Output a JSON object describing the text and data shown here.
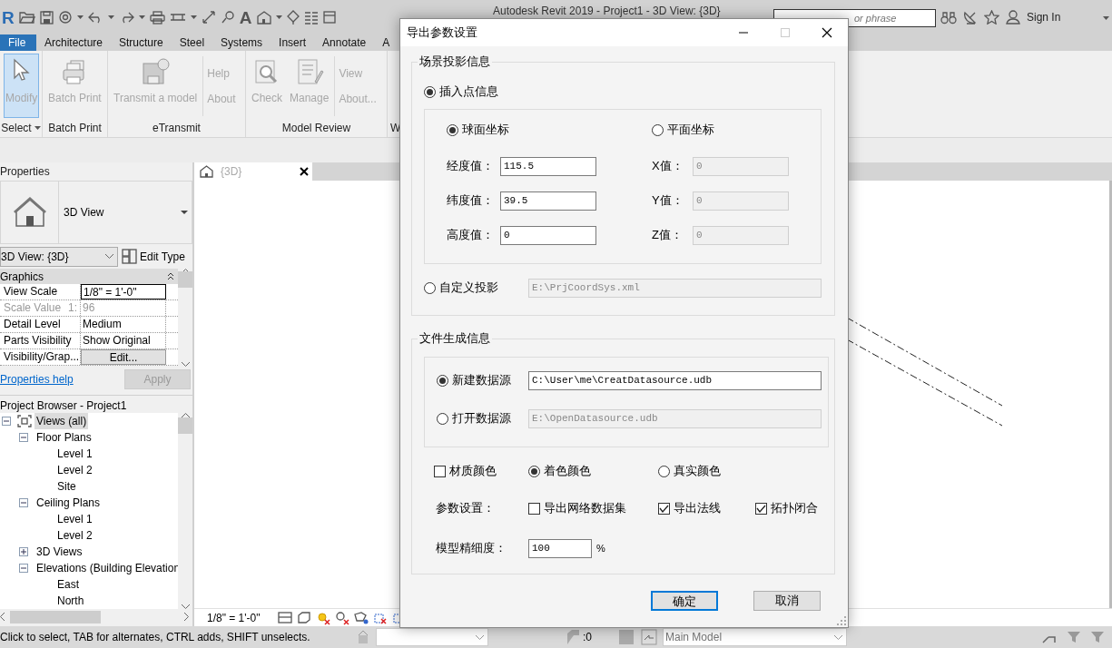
{
  "app": {
    "logo": "R",
    "text_tool": "A",
    "title": "Autodesk Revit 2019 - Project1 - 3D View: {3D}",
    "search": {
      "placeholder": "or phrase"
    },
    "sign_in": "Sign In"
  },
  "ribbon_tabs": [
    {
      "label": "File",
      "kind": "file"
    },
    {
      "label": "Architecture",
      "kind": "tab"
    },
    {
      "label": "Structure",
      "kind": "tab"
    },
    {
      "label": "Steel",
      "kind": "tab"
    },
    {
      "label": "Systems",
      "kind": "tab"
    },
    {
      "label": "Insert",
      "kind": "tab"
    },
    {
      "label": "Annotate",
      "kind": "tab"
    },
    {
      "label": "A",
      "kind": "tab"
    }
  ],
  "ribbon_panels": [
    {
      "label": "Select",
      "dropdown": true,
      "items": [
        {
          "kind": "large",
          "label": "Modify",
          "selected": true
        }
      ]
    },
    {
      "label": "Batch Print",
      "items": [
        {
          "kind": "large",
          "label": "Batch Print",
          "selected": false
        }
      ]
    },
    {
      "label": "eTransmit",
      "items": [
        {
          "kind": "large",
          "label": "Transmit a model",
          "selected": false
        },
        {
          "kind": "stack",
          "labels": [
            "Help",
            "About"
          ]
        }
      ]
    },
    {
      "label": "Model Review",
      "items": [
        {
          "kind": "large",
          "label": "Check",
          "selected": false
        },
        {
          "kind": "large",
          "label": "Manage",
          "selected": false
        },
        {
          "kind": "stack",
          "labels": [
            "View",
            "About..."
          ]
        }
      ]
    },
    {
      "label": "W"
    }
  ],
  "properties": {
    "title": "Properties",
    "type_name": "3D View",
    "instance": "3D View: {3D}",
    "edit_type": "Edit Type",
    "group": "Graphics",
    "rows": [
      {
        "name": "View Scale",
        "value": "1/8\" = 1'-0\"",
        "kind": "edit"
      },
      {
        "name": "Scale Value",
        "suffix": "1:",
        "value": "96",
        "kind": "readonly"
      },
      {
        "name": "Detail Level",
        "value": "Medium",
        "kind": "text"
      },
      {
        "name": "Parts Visibility",
        "value": "Show Original",
        "kind": "text"
      },
      {
        "name": "Visibility/Grap...",
        "value": "Edit...",
        "kind": "button"
      }
    ],
    "help_link": "Properties help",
    "apply": {
      "label": "Apply",
      "disabled": true
    }
  },
  "project_browser": {
    "title": "Project Browser - Project1",
    "tree": [
      {
        "label": "Views (all)",
        "expanded": true,
        "selected": true,
        "children": [
          {
            "label": "Floor Plans",
            "expanded": true,
            "selected": false,
            "children": [
              {
                "label": "Level 1",
                "selected": false
              },
              {
                "label": "Level 2",
                "selected": false
              },
              {
                "label": "Site",
                "selected": false
              }
            ]
          },
          {
            "label": "Ceiling Plans",
            "expanded": true,
            "selected": false,
            "children": [
              {
                "label": "Level 1",
                "selected": false
              },
              {
                "label": "Level 2",
                "selected": false
              }
            ]
          },
          {
            "label": "3D Views",
            "expanded": false,
            "selected": false
          },
          {
            "label": "Elevations (Building Elevation",
            "expanded": true,
            "selected": false,
            "children": [
              {
                "label": "East",
                "selected": false
              },
              {
                "label": "North",
                "selected": false
              }
            ]
          }
        ]
      }
    ]
  },
  "view": {
    "tab": "{3D}",
    "scale": "1/8\" = 1'-0\""
  },
  "status_bar": {
    "prompt": "Click to select, TAB for alternates, CTRL adds, SHIFT unselects.",
    "selection_count": ":0",
    "model": "Main Model"
  },
  "dialog": {
    "title": "导出参数设置",
    "projection_group": {
      "legend": "场景投影信息",
      "insert_point": {
        "label": "插入点信息",
        "selected": true
      },
      "coordinate_modes": [
        {
          "label": "球面坐标",
          "selected": true
        },
        {
          "label": "平面坐标",
          "selected": false
        }
      ],
      "spherical_fields": [
        {
          "label": "经度值：",
          "value": "115.5",
          "disabled": false
        },
        {
          "label": "纬度值：",
          "value": "39.5",
          "disabled": false
        },
        {
          "label": "高度值：",
          "value": "0",
          "disabled": false
        }
      ],
      "planar_fields": [
        {
          "label": "X值：",
          "value": "0",
          "disabled": true
        },
        {
          "label": "Y值：",
          "value": "0",
          "disabled": true
        },
        {
          "label": "Z值：",
          "value": "0",
          "disabled": true
        }
      ],
      "custom": {
        "label": "自定义投影",
        "selected": false,
        "value": "E:\\PrjCoordSys.xml",
        "disabled": true
      }
    },
    "file_group": {
      "legend": "文件生成信息",
      "sources": [
        {
          "label": "新建数据源",
          "selected": true,
          "value": "C:\\User\\me\\CreatDatasource.udb",
          "disabled": false
        },
        {
          "label": "打开数据源",
          "selected": false,
          "value": "E:\\OpenDatasource.udb",
          "disabled": true
        }
      ],
      "color_options": [
        {
          "kind": "checkbox",
          "label": "材质颜色",
          "checked": false
        },
        {
          "kind": "radio",
          "label": "着色颜色",
          "selected": true
        },
        {
          "kind": "radio",
          "label": "真实颜色",
          "selected": false
        }
      ],
      "params_label": "参数设置：",
      "params": [
        {
          "label": "导出网络数据集",
          "checked": false
        },
        {
          "label": "导出法线",
          "checked": true
        },
        {
          "label": "拓扑闭合",
          "checked": true
        }
      ],
      "precision": {
        "label": "模型精细度：",
        "value": "100",
        "unit": "%"
      }
    },
    "buttons": [
      {
        "label": "确定",
        "default": true
      },
      {
        "label": "取消",
        "default": false
      }
    ]
  }
}
